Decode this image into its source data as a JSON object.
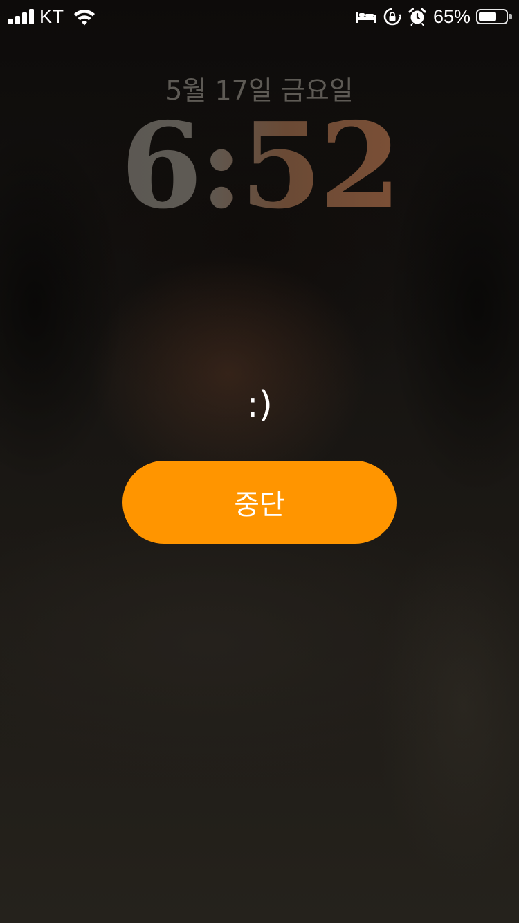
{
  "status_bar": {
    "carrier": "KT",
    "signal_bars": 4,
    "icons": [
      "signal-icon",
      "wifi-icon",
      "bed-icon",
      "orientation-lock-icon",
      "alarm-clock-icon",
      "battery-icon"
    ],
    "battery_percent_text": "65%",
    "battery_level": 0.65
  },
  "lock_screen": {
    "date": "5월 17일 금요일",
    "time": "6:52"
  },
  "alarm": {
    "label": ":)",
    "stop_label": "중단"
  },
  "colors": {
    "stop_button": "#ff9500",
    "text": "#ffffff"
  }
}
